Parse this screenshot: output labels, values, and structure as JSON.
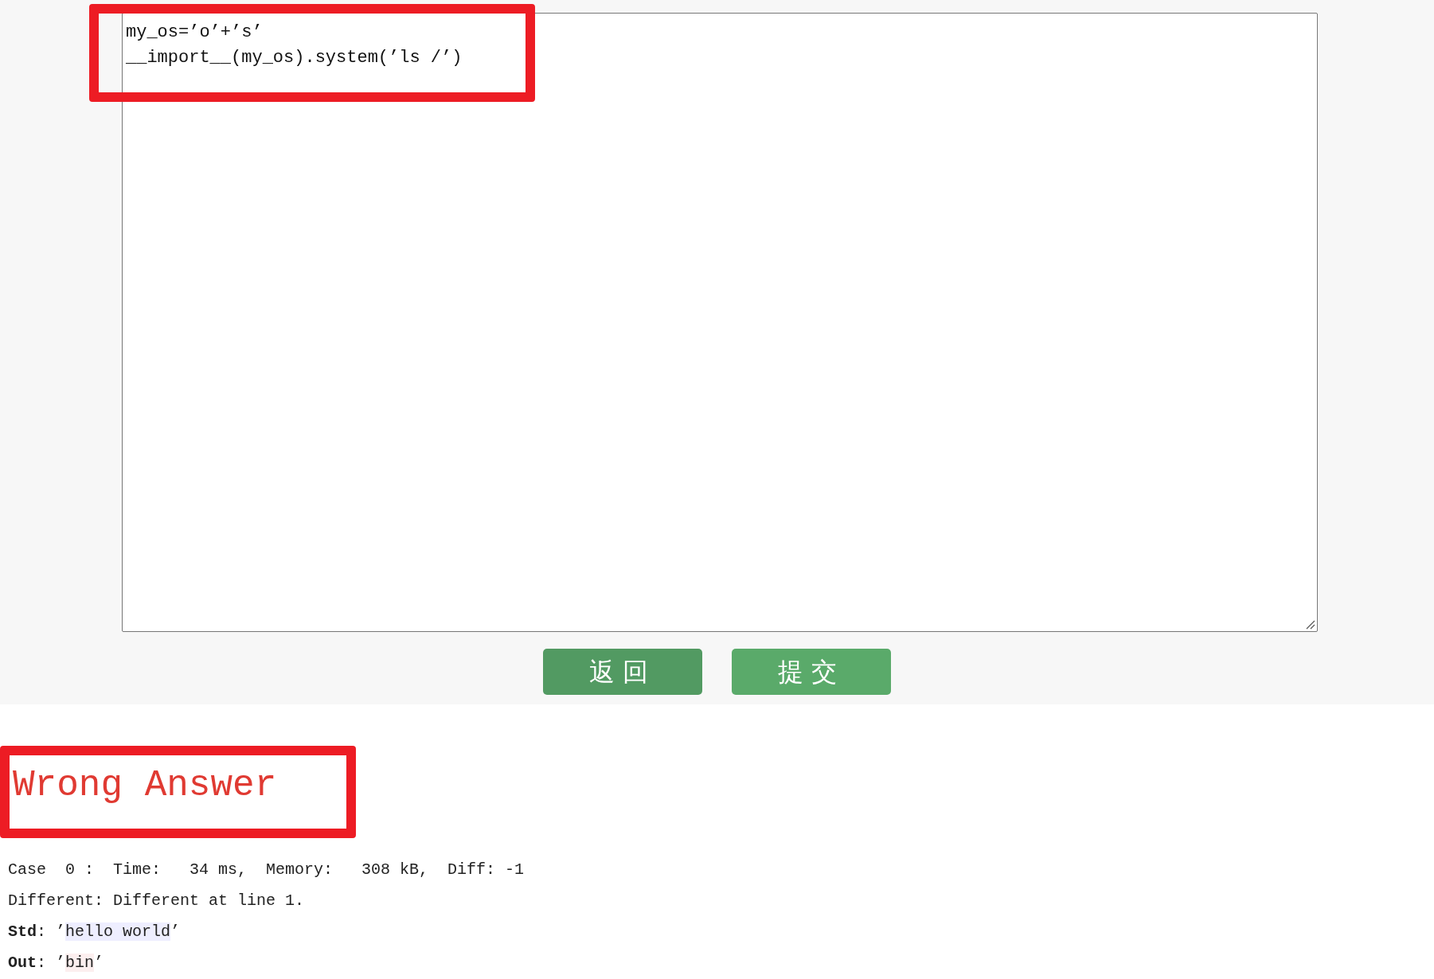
{
  "editor": {
    "lines": [
      "my_os=’o’+’s’",
      "__import__(my_os).system(’ls /’)"
    ]
  },
  "buttons": [
    {
      "label": "返回",
      "kind": "back"
    },
    {
      "label": "提交",
      "kind": "submit"
    }
  ],
  "result": {
    "status": "Wrong Answer",
    "case": "Case  0 :  Time:   34 ms,  Memory:   308 kB,  Diff: -1",
    "different": "Different: Different at line 1.",
    "outputs": [
      {
        "label": "Std",
        "separator": ": ",
        "quote": "’",
        "value": "hello world",
        "kind": "expected"
      },
      {
        "label": "Out",
        "separator": ": ",
        "quote": "’",
        "value": "bin",
        "kind": "actual"
      }
    ]
  }
}
